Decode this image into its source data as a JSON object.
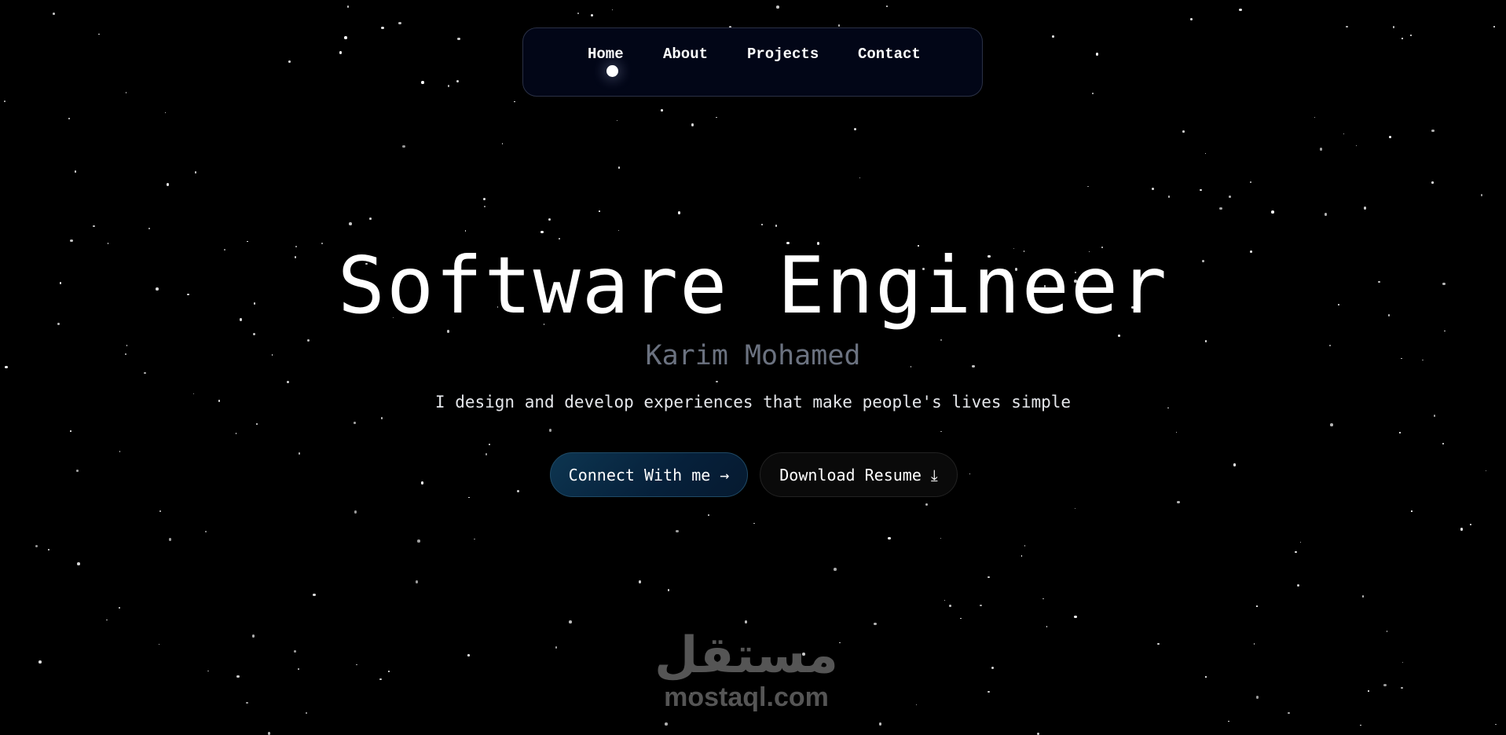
{
  "nav": {
    "items": [
      {
        "label": "Home",
        "active": true
      },
      {
        "label": "About"
      },
      {
        "label": "Projects"
      },
      {
        "label": "Contact"
      }
    ]
  },
  "hero": {
    "title": "Software Engineer",
    "name": "Karim Mohamed",
    "tagline": "I design and develop experiences that make people's lives simple",
    "connect_label": "Connect With me",
    "connect_icon": "→",
    "resume_label": "Download Resume",
    "resume_icon": "⤓"
  },
  "watermark": {
    "arabic": "مستقل",
    "latin": "mostaql.com"
  },
  "colors": {
    "background": "#000000",
    "nav_bg": "#020617",
    "connect_bg": "#0d3550",
    "muted": "#6b7280"
  }
}
